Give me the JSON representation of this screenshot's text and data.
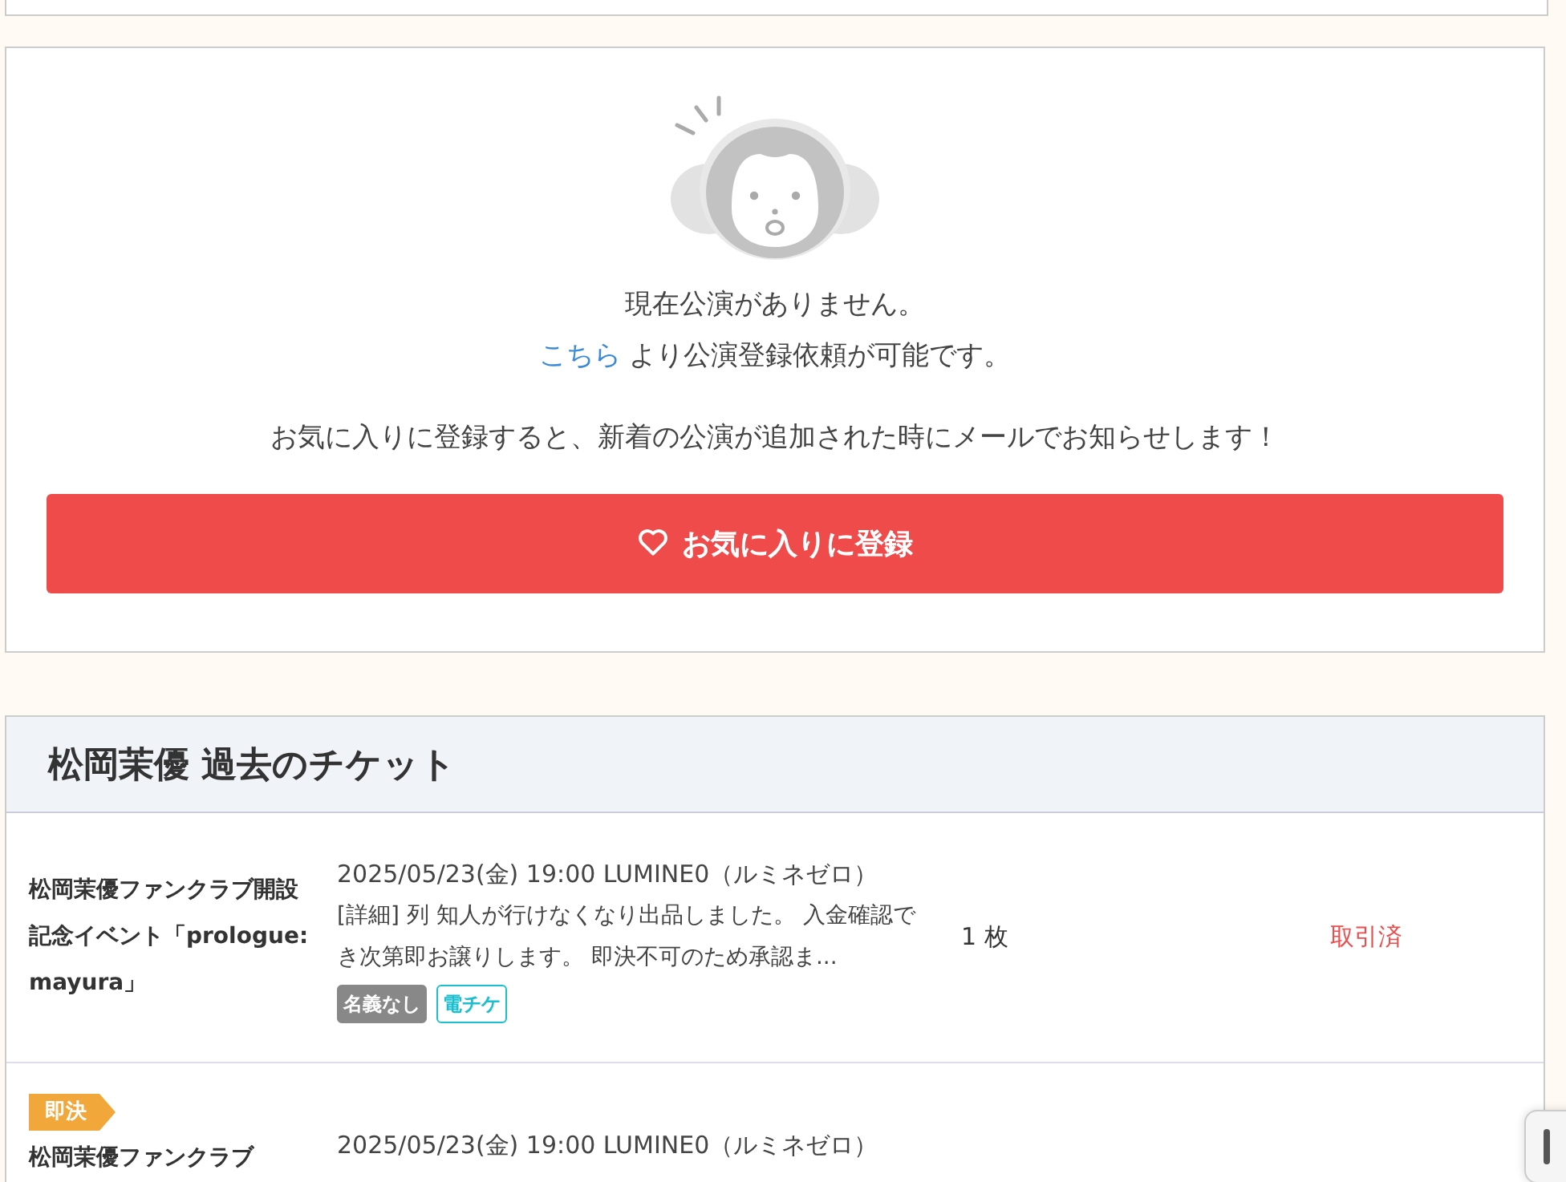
{
  "empty_notice": {
    "message": "現在公演がありません。",
    "link": "こちら",
    "link_suffix": "より公演登録依頼が可能です。",
    "favorite_hint": "お気に入りに登録すると、新着の公演が追加された時にメールでお知らせします！",
    "favorite_button": "お気に入りに登録"
  },
  "past_tickets": {
    "title": "松岡茉優 過去のチケット",
    "rows": [
      {
        "badge": null,
        "event": "松岡茉優ファンクラブ開設記念イベント「prologue:mayura」",
        "date_venue": "2025/05/23(金) 19:00 LUMINE0（ルミネゼロ）",
        "detail": "[詳細] 列 知人が行けなくなり出品しました。 入金確認でき次第即お譲りします。 即決不可のため承認ま...",
        "tags": [
          {
            "label": "名義なし",
            "kind": "filled"
          },
          {
            "label": "電チケ",
            "kind": "outline"
          }
        ],
        "quantity": "1 枚",
        "status": "取引済"
      },
      {
        "badge": "即決",
        "event": "松岡茉優ファンクラブ",
        "date_venue": "2025/05/23(金) 19:00 LUMINE0（ルミネゼロ）",
        "detail": null,
        "tags": [],
        "quantity": null,
        "status": null
      }
    ]
  }
}
